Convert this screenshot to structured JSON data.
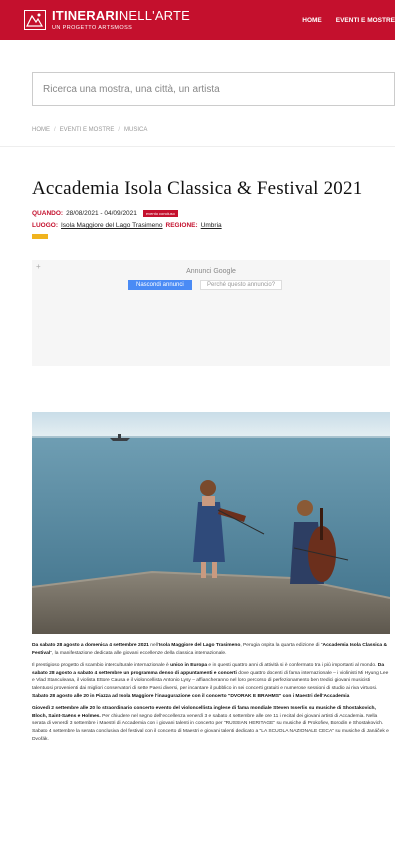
{
  "header": {
    "brand_bold": "ITINERARI",
    "brand_light": "NELL'ARTE",
    "brand_sub": "UN PROGETTO ARTSMOSS",
    "nav": [
      "HOME",
      "EVENTI E MOSTRE"
    ]
  },
  "search": {
    "placeholder": "Ricerca una mostra, una città, un artista"
  },
  "breadcrumb": {
    "items": [
      "HOME",
      "EVENTI E MOSTRE",
      "MUSICA"
    ]
  },
  "event": {
    "title": "Accademia Isola Classica & Festival 2021",
    "when_label": "QUANDO:",
    "dates": "28/08/2021 - 04/09/2021",
    "status_badge": "evento concluso",
    "where_label": "LUOGO:",
    "place": "Isola Maggiore del Lago Trasimeno",
    "region_label": "REGIONE:",
    "region": "Umbria"
  },
  "ad": {
    "label": "Annunci Google",
    "stop_button": "Nascondi annunci",
    "why_button": "Perché questo annuncio?"
  },
  "article": {
    "p1a": "Da sabato 28 agosto a domenica 4 settembre 2021",
    "p1b": " nell'",
    "p1c": "Isola Maggiore del Lago Trasimeno",
    "p1d": ", Perugia ospita la quarta edizione di \"",
    "p1e": "Accademia Isola Classica & Festival",
    "p1f": "\", la manifestazione dedicata alle giovani eccellenze della classica internazionale.",
    "p2a": "Il prestigioso progetto di scambio interculturale internazionale è ",
    "p2b": "unico in Europa",
    "p2c": " e in questi quattro anni di attività si è confermato tra i più importanti al mondo. ",
    "p2d": "Da sabato 28 agosto a sabato 4 settembre un programma denso di appuntamenti e concerti",
    "p2e": " dove quattro docenti di fama internazionale – i violinisti Mi Hyung Lee e Vlad Stanculeasa, il violista Ettore Causa e il violoncellista Antonio Lysy – affiancheranno nel loro percorso di perfezionamento ben tredici giovani musicisti talentuosi provenienti dai migliori conservatori di sette Paesi diversi, per incantare il pubblico in sei concerti gratuiti e numerose sessioni di studio ai riva virtuosi. ",
    "p2f": "Sabato 28 agosto alle 20 in Piazza ad Isola Maggiore l'inaugurazione con il concerto \"DVORAK E BRAHMS\" con i Maestri dell'Accademia",
    "p3a": "Giovedì 2 settembre alle 20 lo straordinario concerto evento del violoncellista inglese di fama mondiale Steven Isserlis su musiche di Shostakovich, Bloch, Saint-Saëns e Holmes.",
    "p3b": " Per chiudere nel segno dell'eccellenza venerdì 3 e sabato 4 settembre alle ore 11 i recital dei giovani artisti di Accademia. Nella serata di venerdì 3 settembre i Maestri di Accademia con i giovani talenti in concerto per \"RUSSIAN HERITAGE\" su musiche di Prokofiev, Borodin e Shostakovich. Sabato 4 settembre la serata conclusiva del festival con il concerto di Maestri e giovani talenti dedicato a \"LA SCUOLA NAZIONALE CECA\" su musiche di Janáček e Dvořák."
  },
  "colors": {
    "brand": "#c4102d",
    "tag": "#f0b31e",
    "ad_button": "#4a8bf5"
  }
}
